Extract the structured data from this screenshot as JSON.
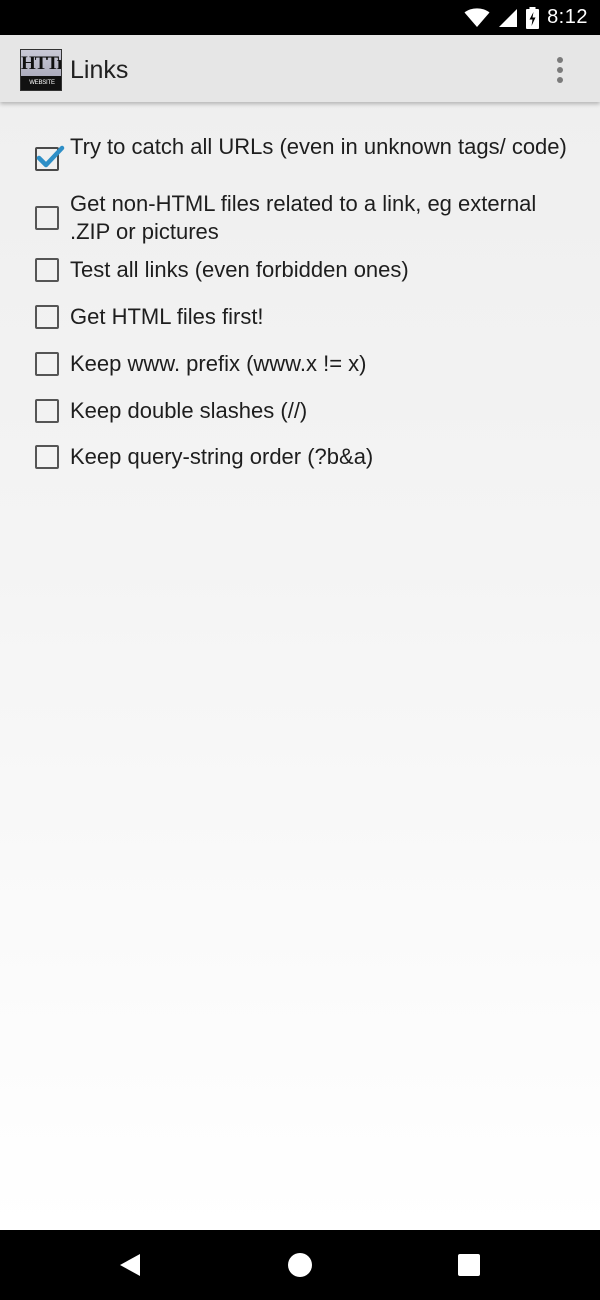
{
  "status_bar": {
    "time": "8:12",
    "icons": [
      "wifi-icon",
      "signal-icon",
      "battery-charging-icon"
    ]
  },
  "app_bar": {
    "logo": {
      "top_text": "HTTrack",
      "bottom_text": "WEBSITE COPIER"
    },
    "title": "Links",
    "overflow_icon": "more-vert-icon"
  },
  "options": [
    {
      "label": "Try to catch all URLs (even in unknown tags/ code)",
      "checked": true
    },
    {
      "label": "Get non-HTML files related to a link, eg external .ZIP or pictures",
      "checked": false
    },
    {
      "label": "Test all links (even forbidden ones)",
      "checked": false
    },
    {
      "label": "Get HTML files first!",
      "checked": false
    },
    {
      "label": "Keep www. prefix (www.x != x)",
      "checked": false
    },
    {
      "label": "Keep double slashes (//)",
      "checked": false
    },
    {
      "label": "Keep query-string order (?b&a)",
      "checked": false
    }
  ],
  "nav_bar": {
    "back_icon": "back-triangle-icon",
    "home_icon": "home-circle-icon",
    "recents_icon": "recents-square-icon"
  },
  "colors": {
    "check_accent": "#2e8fc7",
    "status_bar_bg": "#000000",
    "app_bar_bg": "#e6e6e6"
  }
}
